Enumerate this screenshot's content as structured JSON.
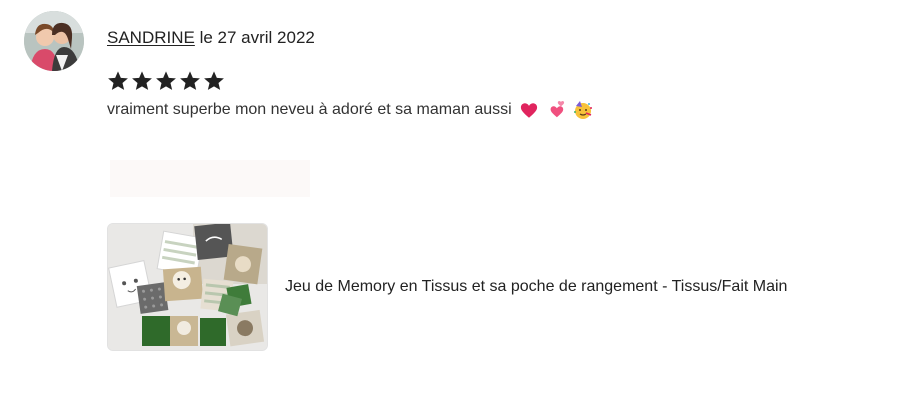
{
  "review": {
    "reviewer_name": "SANDRINE",
    "date_text": " le 27 avril 2022",
    "rating": 5,
    "rating_max": 5,
    "text": "vraiment superbe mon neveu à adoré et sa maman aussi ",
    "emojis": [
      "heart-icon",
      "two-hearts-icon",
      "party-face-icon"
    ]
  },
  "product": {
    "title": "Jeu de Memory en Tissus et sa poche de rangement - Tissus/Fait Main",
    "thumbnail": "memory-fabric-game-photo"
  },
  "colors": {
    "text": "#222222",
    "star": "#222222",
    "heart": "#e0245e"
  }
}
